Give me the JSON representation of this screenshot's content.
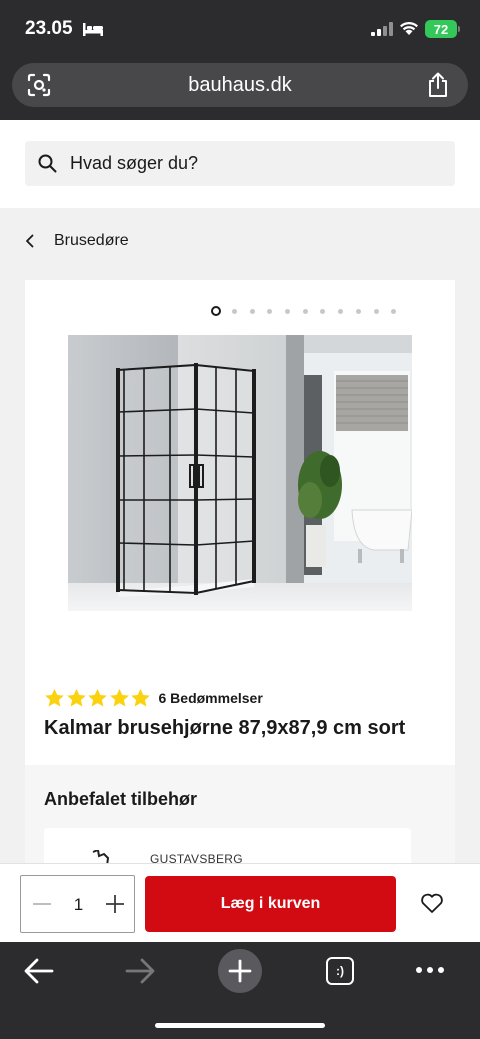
{
  "status_bar": {
    "time": "23.05",
    "battery": "72",
    "icons": [
      "bed-icon",
      "signal-icon",
      "wifi-icon",
      "battery-icon"
    ]
  },
  "browser": {
    "url": "bauhaus.dk",
    "icons": [
      "lens-icon",
      "share-icon"
    ]
  },
  "search": {
    "placeholder": "Hvad søger du?"
  },
  "breadcrumb": {
    "label": "Brusedøre"
  },
  "product": {
    "rating": 5,
    "rating_count_label": "6 Bedømmelser",
    "title": "Kalmar brusehjørne 87,9x87,9 cm sort",
    "gallery_image_count": 11,
    "gallery_active_index": 0
  },
  "accessories": {
    "title": "Anbefalet tilbehør",
    "first_item_brand": "GUSTAVSBERG"
  },
  "cart": {
    "quantity": "1",
    "add_to_cart_label": "Læg i kurven"
  },
  "browser_nav": {
    "tabs_label": ":)"
  },
  "colors": {
    "accent_red": "#d20a11",
    "star_yellow": "#fbd20f",
    "chrome_dark": "#2c2c2e",
    "battery_green": "#34c759"
  }
}
